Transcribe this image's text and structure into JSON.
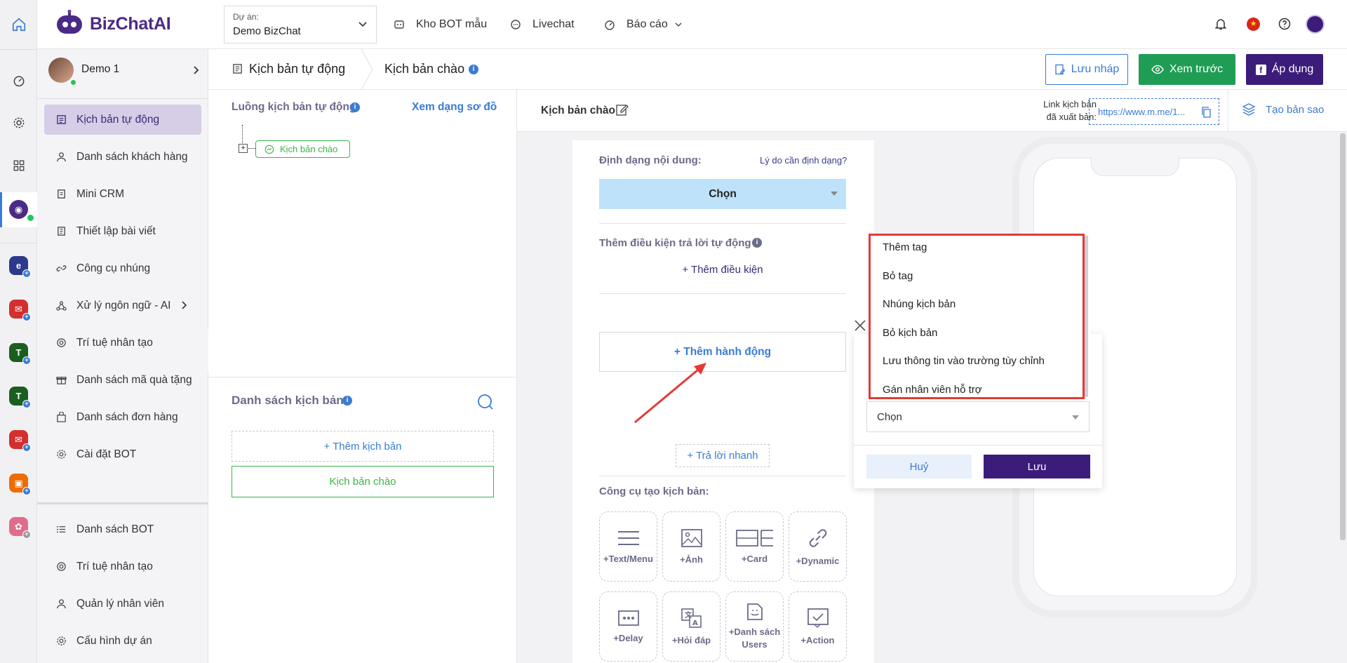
{
  "topbar": {
    "logo": "BizChatAI",
    "project_label": "Dự án:",
    "project_value": "Demo BizChat",
    "nav": [
      "Kho BOT mẫu",
      "Livechat",
      "Báo cáo"
    ]
  },
  "user": {
    "name": "Demo 1"
  },
  "sidebar": {
    "items": [
      "Kịch bản tự động",
      "Danh sách khách hàng",
      "Mini CRM",
      "Thiết lập bài viết",
      "Công cụ nhúng",
      "Xử lý ngôn ngữ - AI",
      "Trí tuệ nhân tạo",
      "Danh sách mã quà tặng",
      "Danh sách đơn hàng",
      "Cài đặt BOT"
    ],
    "bottom_items": [
      "Danh sách BOT",
      "Trí tuệ nhân tạo",
      "Quản lý nhân viên",
      "Cấu hình dự án"
    ]
  },
  "header": {
    "crumb1": "Kịch bản tự động",
    "crumb2": "Kịch bản chào",
    "save_draft": "Lưu nháp",
    "preview": "Xem trước",
    "apply": "Áp dụng"
  },
  "flow": {
    "title": "Luồng kịch bản tự động",
    "diagram_link": "Xem dạng sơ đồ",
    "node": "Kịch bản chào",
    "list_title": "Danh sách kịch bản",
    "add_script": "+ Thêm kịch bản",
    "script_item": "Kịch bản chào"
  },
  "editor": {
    "script_name": "Kịch bản chào",
    "link_label_1": "Link kịch bản",
    "link_label_2": "đã xuất bản:",
    "link_value": "https://www.m.me/1...",
    "copy": "Tạo bản sao",
    "format_label": "Định dạng nội dung:",
    "format_why": "Lý do cần định dạng?",
    "format_select": "Chọn",
    "cond_label": "Thêm điều kiện trả lời tự động",
    "add_cond": "+ Thêm điều kiện",
    "add_action": "+ Thêm hành động",
    "quick_reply": "+ Trả lời nhanh",
    "tools_label": "Công cụ tạo kịch bản:",
    "tools": [
      "+Text/Menu",
      "+Ảnh",
      "+Card",
      "+Dynamic",
      "+Delay",
      "+Hỏi đáp",
      "+Danh sách Users",
      "+Action"
    ]
  },
  "popup": {
    "options": [
      "Thêm tag",
      "Bỏ tag",
      "Nhúng kịch bản",
      "Bỏ kịch bản",
      "Lưu thông tin vào trường tùy chỉnh",
      "Gán nhân viên hỗ trợ"
    ],
    "select": "Chọn",
    "cancel": "Huỷ",
    "save": "Lưu"
  },
  "colors": {
    "brand": "#3c1c7a",
    "green": "#1f9d55",
    "blue": "#3a7bd5",
    "red": "#e53935"
  }
}
